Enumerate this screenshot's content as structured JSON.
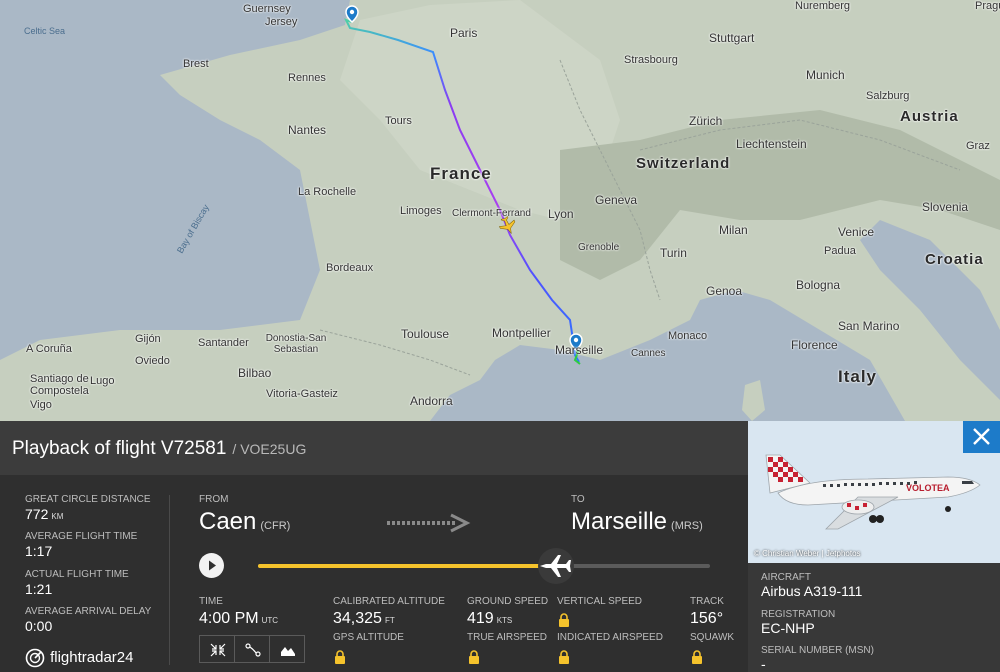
{
  "map": {
    "countries": [
      "France",
      "Switzerland",
      "Austria",
      "Croatia",
      "Italy",
      "Slovenia"
    ],
    "cities": [
      {
        "name": "Guernsey"
      },
      {
        "name": "Jersey"
      },
      {
        "name": "Paris"
      },
      {
        "name": "Stuttgart"
      },
      {
        "name": "Munich"
      },
      {
        "name": "Strasbourg"
      },
      {
        "name": "Rennes"
      },
      {
        "name": "Nantes"
      },
      {
        "name": "Brest"
      },
      {
        "name": "Tours"
      },
      {
        "name": "La Rochelle"
      },
      {
        "name": "Limoges"
      },
      {
        "name": "Clermont-Ferrand"
      },
      {
        "name": "Lyon"
      },
      {
        "name": "Geneva"
      },
      {
        "name": "Zürich"
      },
      {
        "name": "Liechtenstein"
      },
      {
        "name": "Graz"
      },
      {
        "name": "Salzburg"
      },
      {
        "name": "Bordeaux"
      },
      {
        "name": "Grenoble"
      },
      {
        "name": "Milan"
      },
      {
        "name": "Turin"
      },
      {
        "name": "Venice"
      },
      {
        "name": "Padua"
      },
      {
        "name": "Genoa"
      },
      {
        "name": "Bologna"
      },
      {
        "name": "Toulouse"
      },
      {
        "name": "Montpellier"
      },
      {
        "name": "Marseille"
      },
      {
        "name": "Monaco"
      },
      {
        "name": "Cannes"
      },
      {
        "name": "San Marino"
      },
      {
        "name": "Florence"
      },
      {
        "name": "Santander"
      },
      {
        "name": "Donostia-San Sebastian"
      },
      {
        "name": "Bilbao"
      },
      {
        "name": "Vitoria-Gasteiz"
      },
      {
        "name": "Gijón"
      },
      {
        "name": "Oviedo"
      },
      {
        "name": "A Coruña"
      },
      {
        "name": "Santiago de Compostela"
      },
      {
        "name": "Lugo"
      },
      {
        "name": "Vigo"
      },
      {
        "name": "Andorra"
      },
      {
        "name": "Bay of Biscay"
      },
      {
        "name": "Celtic Sea"
      },
      {
        "name": "Nuremberg"
      },
      {
        "name": "Prague"
      }
    ]
  },
  "header": {
    "title": "Playback of flight V72581",
    "subtitle": "/ VOE25UG"
  },
  "stats": {
    "gc_distance_label": "GREAT CIRCLE DISTANCE",
    "gc_distance_value": "772",
    "gc_distance_unit": "KM",
    "avg_flight_time_label": "AVERAGE FLIGHT TIME",
    "avg_flight_time_value": "1:17",
    "actual_flight_time_label": "ACTUAL FLIGHT TIME",
    "actual_flight_time_value": "1:21",
    "avg_arrival_delay_label": "AVERAGE ARRIVAL DELAY",
    "avg_arrival_delay_value": "0:00"
  },
  "brand": "flightradar24",
  "route": {
    "from_label": "FROM",
    "from_city": "Caen",
    "from_code": "(CFR)",
    "to_label": "TO",
    "to_city": "Marseille",
    "to_code": "(MRS)"
  },
  "playback": {
    "progress": 0.66
  },
  "telemetry": {
    "time_label": "TIME",
    "time_value": "4:00 PM",
    "time_unit": "UTC",
    "cal_alt_label": "CALIBRATED ALTITUDE",
    "cal_alt_value": "34,325",
    "cal_alt_unit": "FT",
    "gps_alt_label": "GPS ALTITUDE",
    "ground_speed_label": "GROUND SPEED",
    "ground_speed_value": "419",
    "ground_speed_unit": "KTS",
    "true_airspeed_label": "TRUE AIRSPEED",
    "vertical_speed_label": "VERTICAL SPEED",
    "indicated_airspeed_label": "INDICATED AIRSPEED",
    "track_label": "TRACK",
    "track_value": "156°",
    "squawk_label": "SQUAWK"
  },
  "photo": {
    "credit": "© Christian Weber | Jetphotos",
    "livery_text": "VOLOTEA"
  },
  "aircraft": {
    "aircraft_label": "AIRCRAFT",
    "aircraft_value": "Airbus A319-111",
    "registration_label": "REGISTRATION",
    "registration_value": "EC-NHP",
    "serial_label": "SERIAL NUMBER (MSN)",
    "serial_value": "-"
  },
  "colors": {
    "progress": "#f5c32c",
    "close_button": "#1d7bc9",
    "track_start": "#4fd1a5",
    "track_mid": "#9b3df0",
    "track_end": "#2b5cff"
  }
}
